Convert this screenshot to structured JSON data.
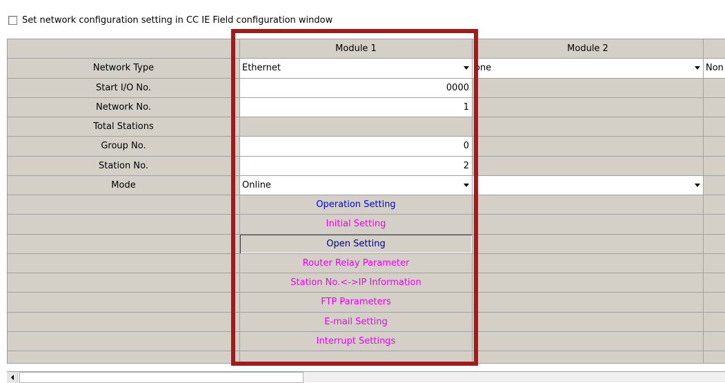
{
  "config_checkbox": {
    "label": "Set network configuration setting in CC IE Field configuration window",
    "checked": false
  },
  "columns": {
    "module1": "Module 1",
    "module2": "Module 2"
  },
  "labels": {
    "network_type": "Network Type",
    "start_io": "Start I/O No.",
    "network_no": "Network No.",
    "total_stations": "Total Stations",
    "group_no": "Group No.",
    "station_no": "Station No.",
    "mode": "Mode"
  },
  "module1": {
    "network_type": "Ethernet",
    "start_io": "0000",
    "network_no": "1",
    "group_no": "0",
    "station_no": "2",
    "mode": "Online",
    "buttons": {
      "operation_setting": "Operation Setting",
      "initial_setting": "Initial Setting",
      "open_setting": "Open Setting",
      "router_relay": "Router Relay Parameter",
      "station_ip": "Station No.<->IP Information",
      "ftp": "FTP Parameters",
      "email": "E-mail Setting",
      "interrupt": "Interrupt Settings"
    }
  },
  "module2": {
    "network_type": "one"
  },
  "module3": {
    "network_type": "Non"
  },
  "colors": {
    "grid_bg": "#d4d0c8",
    "highlight_border": "#a01c1c",
    "link_blue": "#0000ee",
    "link_magenta": "#ee00ee",
    "link_navy": "#000080"
  }
}
